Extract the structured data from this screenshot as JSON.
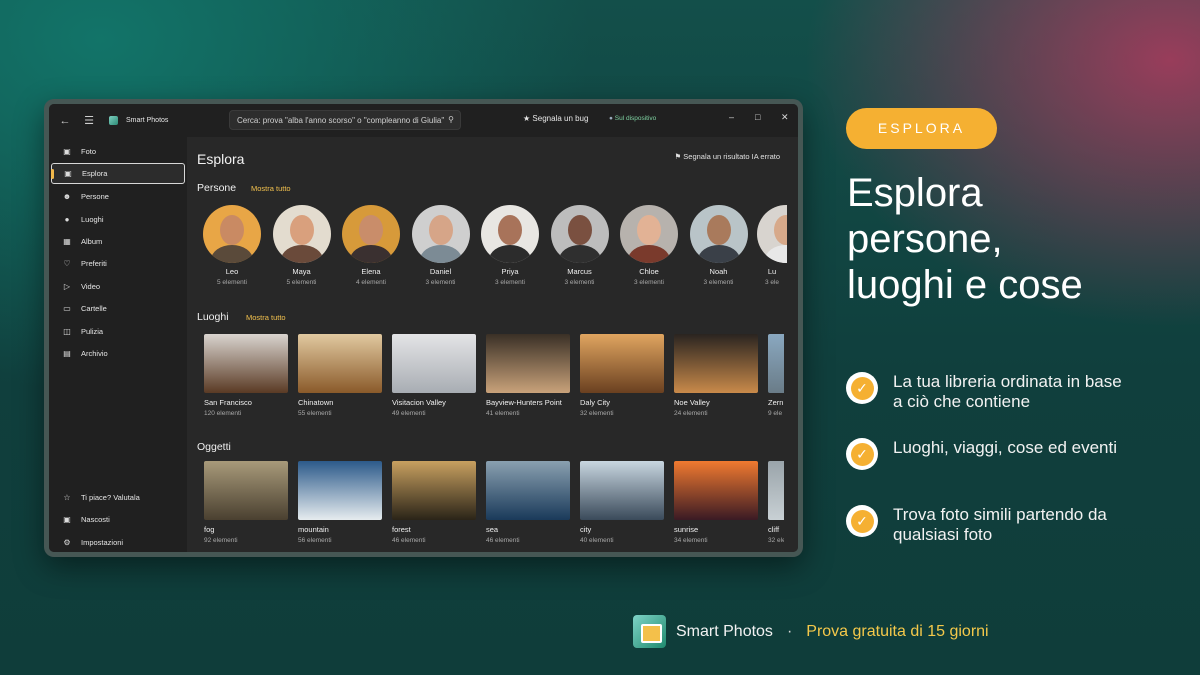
{
  "window": {
    "app_title": "Smart Photos",
    "search_placeholder": "Cerca: prova \"alba l'anno scorso\" o \"compleanno di Giulia\"",
    "bug_label": "Segnala un bug",
    "device_label": "Sul dispositivo",
    "icons": {
      "back": "back-arrow-icon",
      "menu": "hamburger-icon",
      "search": "search-icon",
      "bug": "bug-icon",
      "lock": "lock-icon",
      "minimize": "minimize-icon",
      "maximize": "maximize-icon",
      "close": "close-icon"
    }
  },
  "sidebar": {
    "items": [
      {
        "label": "Foto",
        "icon": "image-icon"
      },
      {
        "label": "Esplora",
        "icon": "explore-icon",
        "active": true
      },
      {
        "label": "Persone",
        "icon": "people-icon"
      },
      {
        "label": "Luoghi",
        "icon": "places-icon"
      },
      {
        "label": "Album",
        "icon": "album-icon"
      },
      {
        "label": "Preferiti",
        "icon": "heart-icon"
      },
      {
        "label": "Video",
        "icon": "video-icon"
      },
      {
        "label": "Cartelle",
        "icon": "folder-icon"
      },
      {
        "label": "Pulizia",
        "icon": "trash-icon"
      },
      {
        "label": "Archivio",
        "icon": "archive-icon"
      }
    ],
    "bottom": [
      {
        "label": "Ti piace? Valutala",
        "icon": "star-icon"
      },
      {
        "label": "Nascosti",
        "icon": "lock-icon"
      },
      {
        "label": "Impostazioni",
        "icon": "gear-icon"
      }
    ]
  },
  "main": {
    "title": "Esplora",
    "report_label": "Segnala un risultato IA errato",
    "people": {
      "title": "Persone",
      "more": "Mostra tutto",
      "items": [
        {
          "name": "Leo",
          "count": "5 elementi",
          "skin": "#c98a63",
          "bg": "#e8a646",
          "shirt": "#5a4a3a"
        },
        {
          "name": "Maya",
          "count": "5 elementi",
          "skin": "#d9a07d",
          "bg": "#e3dccf",
          "shirt": "#6a4a3a"
        },
        {
          "name": "Elena",
          "count": "4 elementi",
          "skin": "#c98d6a",
          "bg": "#d79a3a",
          "shirt": "#3a3030"
        },
        {
          "name": "Daniel",
          "count": "3 elementi",
          "skin": "#d6a588",
          "bg": "#cfcfcf",
          "shirt": "#7c8b95"
        },
        {
          "name": "Priya",
          "count": "3 elementi",
          "skin": "#a8735a",
          "bg": "#e8e6e2",
          "shirt": "#2c2c2c"
        },
        {
          "name": "Marcus",
          "count": "3 elementi",
          "skin": "#7a5040",
          "bg": "#bdbdbd",
          "shirt": "#2f2f2f"
        },
        {
          "name": "Chloe",
          "count": "3 elementi",
          "skin": "#e2b295",
          "bg": "#b7b2ad",
          "shirt": "#7a3a2c"
        },
        {
          "name": "Noah",
          "count": "3 elementi",
          "skin": "#a97a5c",
          "bg": "#b9c4c8",
          "shirt": "#3a4048"
        },
        {
          "name": "Lu",
          "count": "3 ele",
          "skin": "#d7a98a",
          "bg": "#d8d4cf",
          "shirt": "#e8e8e8"
        }
      ]
    },
    "places": {
      "title": "Luoghi",
      "more": "Mostra tutto",
      "items": [
        {
          "name": "San Francisco",
          "count": "120 elementi",
          "colors": [
            "#d9d4cf",
            "#5a3a24"
          ]
        },
        {
          "name": "Chinatown",
          "count": "55 elementi",
          "colors": [
            "#e1c9a0",
            "#8a5a2a"
          ]
        },
        {
          "name": "Visitacion Valley",
          "count": "49 elementi",
          "colors": [
            "#e4e4e6",
            "#a8adb3"
          ]
        },
        {
          "name": "Bayview-Hunters Point",
          "count": "41 elementi",
          "colors": [
            "#3a3026",
            "#c9a27a"
          ]
        },
        {
          "name": "Daly City",
          "count": "32 elementi",
          "colors": [
            "#e0a560",
            "#6a4020"
          ]
        },
        {
          "name": "Noe Valley",
          "count": "24 elementi",
          "colors": [
            "#2a2420",
            "#c98a4a"
          ]
        },
        {
          "name": "Zern",
          "count": "9 ele",
          "colors": [
            "#8aa8c0",
            "#6a7c88"
          ]
        }
      ]
    },
    "objects": {
      "title": "Oggetti",
      "items": [
        {
          "name": "fog",
          "count": "92 elementi",
          "colors": [
            "#a89a7a",
            "#4a4030"
          ]
        },
        {
          "name": "mountain",
          "count": "56 elementi",
          "colors": [
            "#2c5a8a",
            "#e6ecef"
          ]
        },
        {
          "name": "forest",
          "count": "46 elementi",
          "colors": [
            "#c8a060",
            "#2a2418"
          ]
        },
        {
          "name": "sea",
          "count": "46 elementi",
          "colors": [
            "#8aa0b0",
            "#1a3a5a"
          ]
        },
        {
          "name": "city",
          "count": "40 elementi",
          "colors": [
            "#c8d6e0",
            "#3a4a5a"
          ]
        },
        {
          "name": "sunrise",
          "count": "34 elementi",
          "colors": [
            "#f07a30",
            "#3a1a24"
          ]
        },
        {
          "name": "cliff",
          "count": "32 ele",
          "colors": [
            "#9aa4aa",
            "#c8d0d4"
          ]
        }
      ]
    }
  },
  "promo": {
    "pill": "ESPLORA",
    "headline_lines": [
      "Esplora",
      "persone,",
      "luoghi e cose"
    ],
    "bullets": [
      {
        "lines": [
          "La tua libreria ordinata in base",
          "a ciò che contiene"
        ]
      },
      {
        "lines": [
          "Luoghi, viaggi, cose ed eventi"
        ]
      },
      {
        "lines": [
          "Trova foto simili partendo da",
          "qualsiasi foto"
        ]
      }
    ],
    "footer_app": "Smart Photos",
    "footer_sep": "·",
    "footer_trial": "Prova gratuita di 15 giorni",
    "accent": "#f5b032",
    "trial_color": "#f4c84a"
  }
}
